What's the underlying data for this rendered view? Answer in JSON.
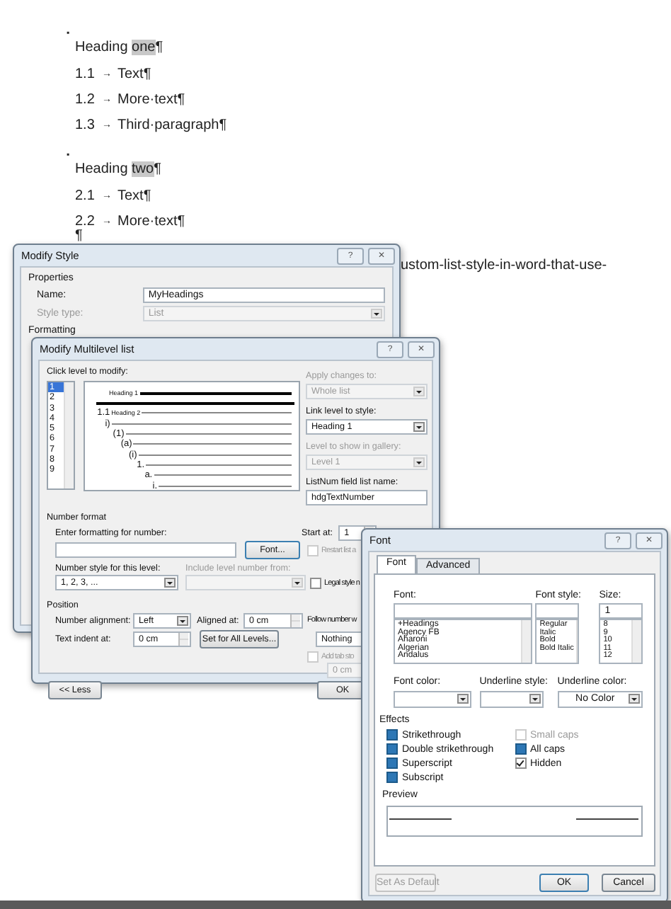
{
  "document": {
    "lines": [
      {
        "kind": "bullet",
        "text": "▪"
      },
      {
        "kind": "heading",
        "text": "Heading ",
        "shaded": "one",
        "end": "¶"
      },
      {
        "kind": "numbered",
        "number": "1.1",
        "tab": "→",
        "text": "Text¶"
      },
      {
        "kind": "numbered",
        "number": "1.2",
        "tab": "→",
        "text": "More·text¶"
      },
      {
        "kind": "numbered",
        "number": "1.3",
        "tab": "→",
        "text": "Third·paragraph¶"
      },
      {
        "kind": "bullet",
        "text": "▪"
      },
      {
        "kind": "heading",
        "text": "Heading ",
        "shaded": "two",
        "end": "¶"
      },
      {
        "kind": "numbered",
        "number": "2.1",
        "tab": "→",
        "text": "Text¶"
      },
      {
        "kind": "numbered",
        "number": "2.2",
        "tab": "→",
        "text": "More·text¶"
      },
      {
        "kind": "mark",
        "text": "¶"
      }
    ],
    "background_text": "ustom-list-style-in-word-that-use-"
  },
  "modify_style": {
    "title": "Modify Style",
    "help": "?",
    "close": "✕",
    "properties": "Properties",
    "fields": [
      {
        "label": "Name:",
        "value": "MyHeadings",
        "kind": "input",
        "disabled": false
      },
      {
        "label": "Style type:",
        "value": "List",
        "kind": "select",
        "disabled": true
      }
    ],
    "formatting": "Formatting"
  },
  "multilevel": {
    "title": "Modify Multilevel list",
    "help": "?",
    "close": "✕",
    "click_level_label": "Click level to modify:",
    "levels": [
      {
        "label": "1",
        "selected": true
      },
      {
        "label": "2",
        "selected": false
      },
      {
        "label": "3",
        "selected": false
      },
      {
        "label": "4",
        "selected": false
      },
      {
        "label": "5",
        "selected": false
      },
      {
        "label": "6",
        "selected": false
      },
      {
        "label": "7",
        "selected": false
      },
      {
        "label": "8",
        "selected": false
      },
      {
        "label": "9",
        "selected": false
      }
    ],
    "preview": [
      {
        "label": "Heading 1",
        "selected": true
      },
      {
        "number": "1.1",
        "label": "Heading 2",
        "selected": false
      },
      {
        "number": "i)",
        "selected": false
      },
      {
        "number": "(1)",
        "selected": false
      },
      {
        "number": "(a)",
        "selected": false
      },
      {
        "number": "(i)",
        "selected": false
      },
      {
        "number": "1.",
        "selected": false
      },
      {
        "number": "a.",
        "selected": false
      },
      {
        "number": "i.",
        "selected": false
      }
    ],
    "right_fields": [
      {
        "label": "Apply changes to:",
        "value": "Whole list",
        "kind": "select",
        "disabled": true
      },
      {
        "label": "Link level to style:",
        "value": "Heading 1",
        "kind": "select",
        "disabled": false
      },
      {
        "label": "Level to show in gallery:",
        "value": "Level 1",
        "kind": "select",
        "disabled": true
      },
      {
        "label": "ListNum field list name:",
        "value": "hdgTextNumber",
        "kind": "input",
        "disabled": false
      }
    ],
    "number_format": {
      "heading": "Number format",
      "enter_label": "Enter formatting for number:",
      "font_button": "Font...",
      "start_label": "Start at:",
      "start_value": "1",
      "restart": {
        "label": "Restart list a",
        "checked": false,
        "disabled": true
      },
      "style_label": "Number style for this level:",
      "style_value": "1, 2, 3, ...",
      "include_label": "Include level number from:",
      "legal": {
        "label": "Legal style n",
        "checked": false,
        "disabled": false
      }
    },
    "position": {
      "heading": "Position",
      "alignment_label": "Number alignment:",
      "alignment_value": "Left",
      "aligned_label": "Aligned at:",
      "aligned_value": "0 cm",
      "indent_label": "Text indent at:",
      "indent_value": "0 cm",
      "set_all_button": "Set for All Levels...",
      "follow_label": "Follow number w",
      "follow_value": "Nothing",
      "add_tab": {
        "label": "Add tab sto",
        "checked": false,
        "disabled": true
      },
      "tab_value": "0 cm"
    },
    "less_button": "<< Less",
    "ok_button": "OK"
  },
  "font_dialog": {
    "title": "Font",
    "help": "?",
    "close": "✕",
    "tabs": [
      {
        "label": "Font",
        "selected": true
      },
      {
        "label": "Advanced",
        "selected": false
      }
    ],
    "font": {
      "label": "Font:",
      "items": [
        "+Headings",
        "Agency FB",
        "Aharoni",
        "Algerian",
        "Andalus"
      ]
    },
    "style": {
      "label": "Font style:",
      "items": [
        "Regular",
        "Italic",
        "Bold",
        "Bold Italic"
      ]
    },
    "size": {
      "label": "Size:",
      "value": "1",
      "items": [
        "8",
        "9",
        "10",
        "11",
        "12"
      ]
    },
    "font_color_label": "Font color:",
    "underline_style_label": "Underline style:",
    "underline_color_label": "Underline color:",
    "underline_color_value": "No Color",
    "effects_heading": "Effects",
    "effects_left": [
      {
        "label": "Strikethrough",
        "checked": false,
        "indeterminate": true,
        "disabled": false
      },
      {
        "label": "Double strikethrough",
        "checked": false,
        "indeterminate": true,
        "disabled": false
      },
      {
        "label": "Superscript",
        "checked": false,
        "indeterminate": true,
        "disabled": false
      },
      {
        "label": "Subscript",
        "checked": false,
        "indeterminate": true,
        "disabled": false
      }
    ],
    "effects_right": [
      {
        "label": "Small caps",
        "checked": false,
        "indeterminate": false,
        "disabled": true
      },
      {
        "label": "All caps",
        "checked": false,
        "indeterminate": true,
        "disabled": false
      },
      {
        "label": "Hidden",
        "checked": true,
        "indeterminate": false,
        "disabled": false
      }
    ],
    "preview_heading": "Preview",
    "default_button": {
      "label": "Set As Default",
      "disabled": true
    },
    "ok_button": "OK",
    "cancel_button": "Cancel"
  }
}
